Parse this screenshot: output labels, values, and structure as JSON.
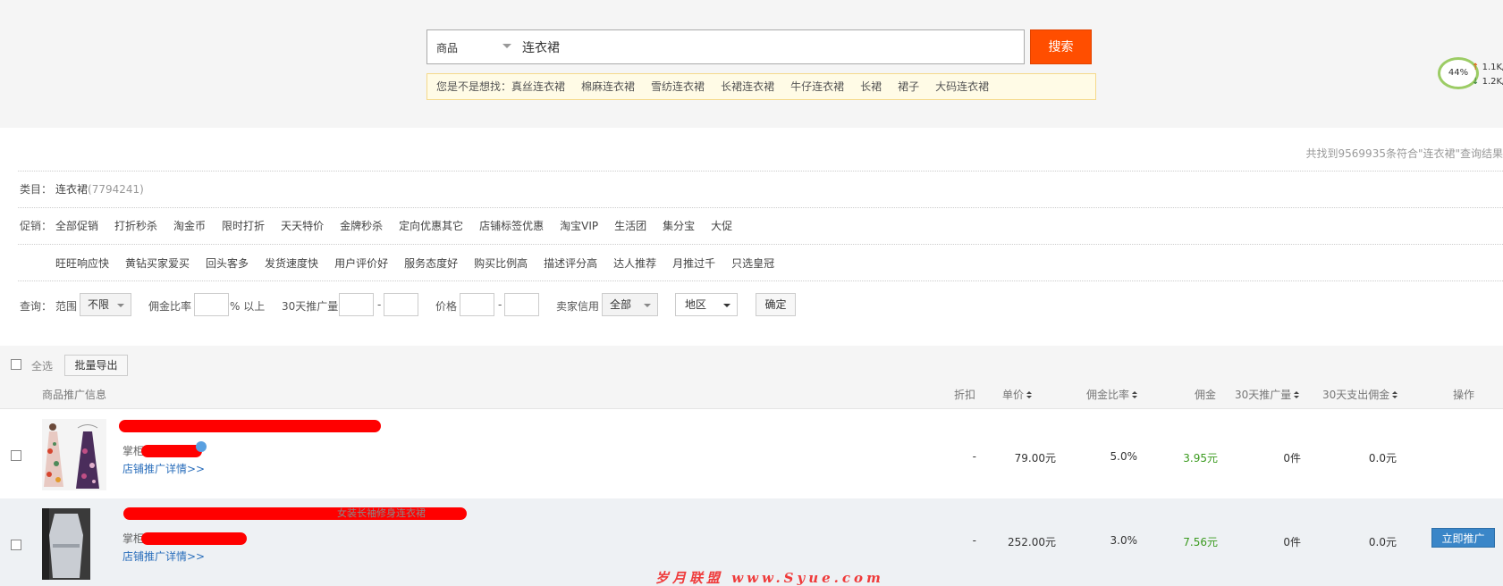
{
  "search": {
    "type_label": "商品",
    "query": "连衣裙",
    "button_label": "搜索",
    "suggest_prefix": "您是不是想找：",
    "suggestions": [
      "真丝连衣裙",
      "棉麻连衣裙",
      "雪纺连衣裙",
      "长裙连衣裙",
      "牛仔连衣裙",
      "长裙",
      "裙子",
      "大码连衣裙"
    ]
  },
  "speed_widget": {
    "percent": "44%",
    "up": "1.1K/",
    "down": "1.2K/"
  },
  "filters": {
    "result_count": "共找到9569935条符合\"连衣裙\"查询结果",
    "category_label": "类目：",
    "category_name": "连衣裙",
    "category_count": "(7794241)",
    "promo_label": "促销：",
    "promo_row1": [
      "全部促销",
      "打折秒杀",
      "淘金币",
      "限时打折",
      "天天特价",
      "金牌秒杀",
      "定向优惠其它",
      "店铺标签优惠",
      "淘宝VIP",
      "生活团",
      "集分宝",
      "大促"
    ],
    "promo_row2": [
      "旺旺响应快",
      "黄钻买家爱买",
      "回头客多",
      "发货速度快",
      "用户评价好",
      "服务态度好",
      "购买比例高",
      "描述评分高",
      "达人推荐",
      "月推过千",
      "只选皇冠"
    ],
    "query_label": "查询：",
    "range_label": "范围",
    "range_value": "不限",
    "commission_label": "佣金比率",
    "commission_suffix": "% 以上",
    "sales_label": "30天推广量",
    "dash": "-",
    "price_label": "价格",
    "credit_label": "卖家信用",
    "credit_value": "全部",
    "region_value": "地区",
    "confirm_label": "确定"
  },
  "table": {
    "select_all": "全选",
    "export_label": "批量导出",
    "headers": {
      "info": "商品推广信息",
      "discount": "折扣",
      "price": "单价",
      "commission_rate": "佣金比率",
      "commission": "佣金",
      "sales30": "30天推广量",
      "spend30": "30天支出佣金",
      "action": "操作"
    },
    "rows": [
      {
        "shop_label": "掌柜",
        "shop_link": "店铺推广详情>>",
        "discount": "-",
        "price": "79.00元",
        "rate": "5.0%",
        "commission": "3.95元",
        "sales": "0件",
        "spend": "0.0元"
      },
      {
        "shop_label": "掌柜",
        "shop_link": "店铺推广详情>>",
        "discount": "-",
        "price": "252.00元",
        "rate": "3.0%",
        "commission": "7.56元",
        "sales": "0件",
        "spend": "0.0元",
        "action": "立即推广",
        "title_tail": "女装长袖修身连衣裙"
      }
    ]
  },
  "watermark": "岁月联盟 www.Syue.com"
}
